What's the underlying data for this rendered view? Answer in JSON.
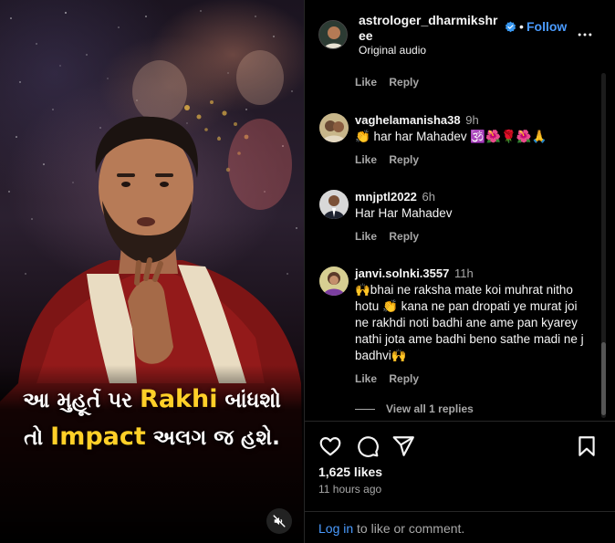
{
  "media": {
    "caption_line1_pre": "આ મુહૂર્ત પર ",
    "caption_line1_hl": "Rakhi",
    "caption_line1_post": " બાંધશો",
    "caption_line2_pre": "તો ",
    "caption_line2_hl": "Impact",
    "caption_line2_post": " અલગ જ હશે.",
    "highlight_color": "#ffd028",
    "mute_icon": "speaker-muted-icon"
  },
  "post": {
    "username": "astrologer_dharmikshree",
    "verified": true,
    "follow_label": "Follow",
    "separator": "•",
    "audio_label": "Original audio",
    "more_icon": "more-options-icon"
  },
  "comments": {
    "top_actions": {
      "like": "Like",
      "reply": "Reply"
    },
    "items": [
      {
        "user": "vaghelamanisha38",
        "time": "9h",
        "text": "👏 har har Mahadev 🕉️🌺🌹🌺🙏",
        "like": "Like",
        "reply": "Reply"
      },
      {
        "user": "mnjptl2022",
        "time": "6h",
        "text": "Har Har Mahadev",
        "like": "Like",
        "reply": "Reply"
      },
      {
        "user": "janvi.solnki.3557",
        "time": "11h",
        "text": "🙌bhai ne raksha mate koi muhrat nitho hotu 👏 kana ne pan dropati ye murat joi ne rakhdi noti badhi ane ame pan kyarey nathi jota ame badhi beno sathe madi ne j badhvi🙌",
        "like": "Like",
        "reply": "Reply"
      }
    ],
    "view_replies": "View all 1 replies"
  },
  "actions": {
    "like_icon": "heart-icon",
    "comment_icon": "comment-icon",
    "share_icon": "share-icon",
    "save_icon": "bookmark-icon",
    "likes": "1,625 likes",
    "time_ago": "11 hours ago"
  },
  "login": {
    "link": "Log in",
    "rest": " to like or comment."
  },
  "colors": {
    "accent": "#4a9bff",
    "muted_text": "#a8a8a8",
    "text": "#f5f5f5",
    "background": "#000000"
  }
}
